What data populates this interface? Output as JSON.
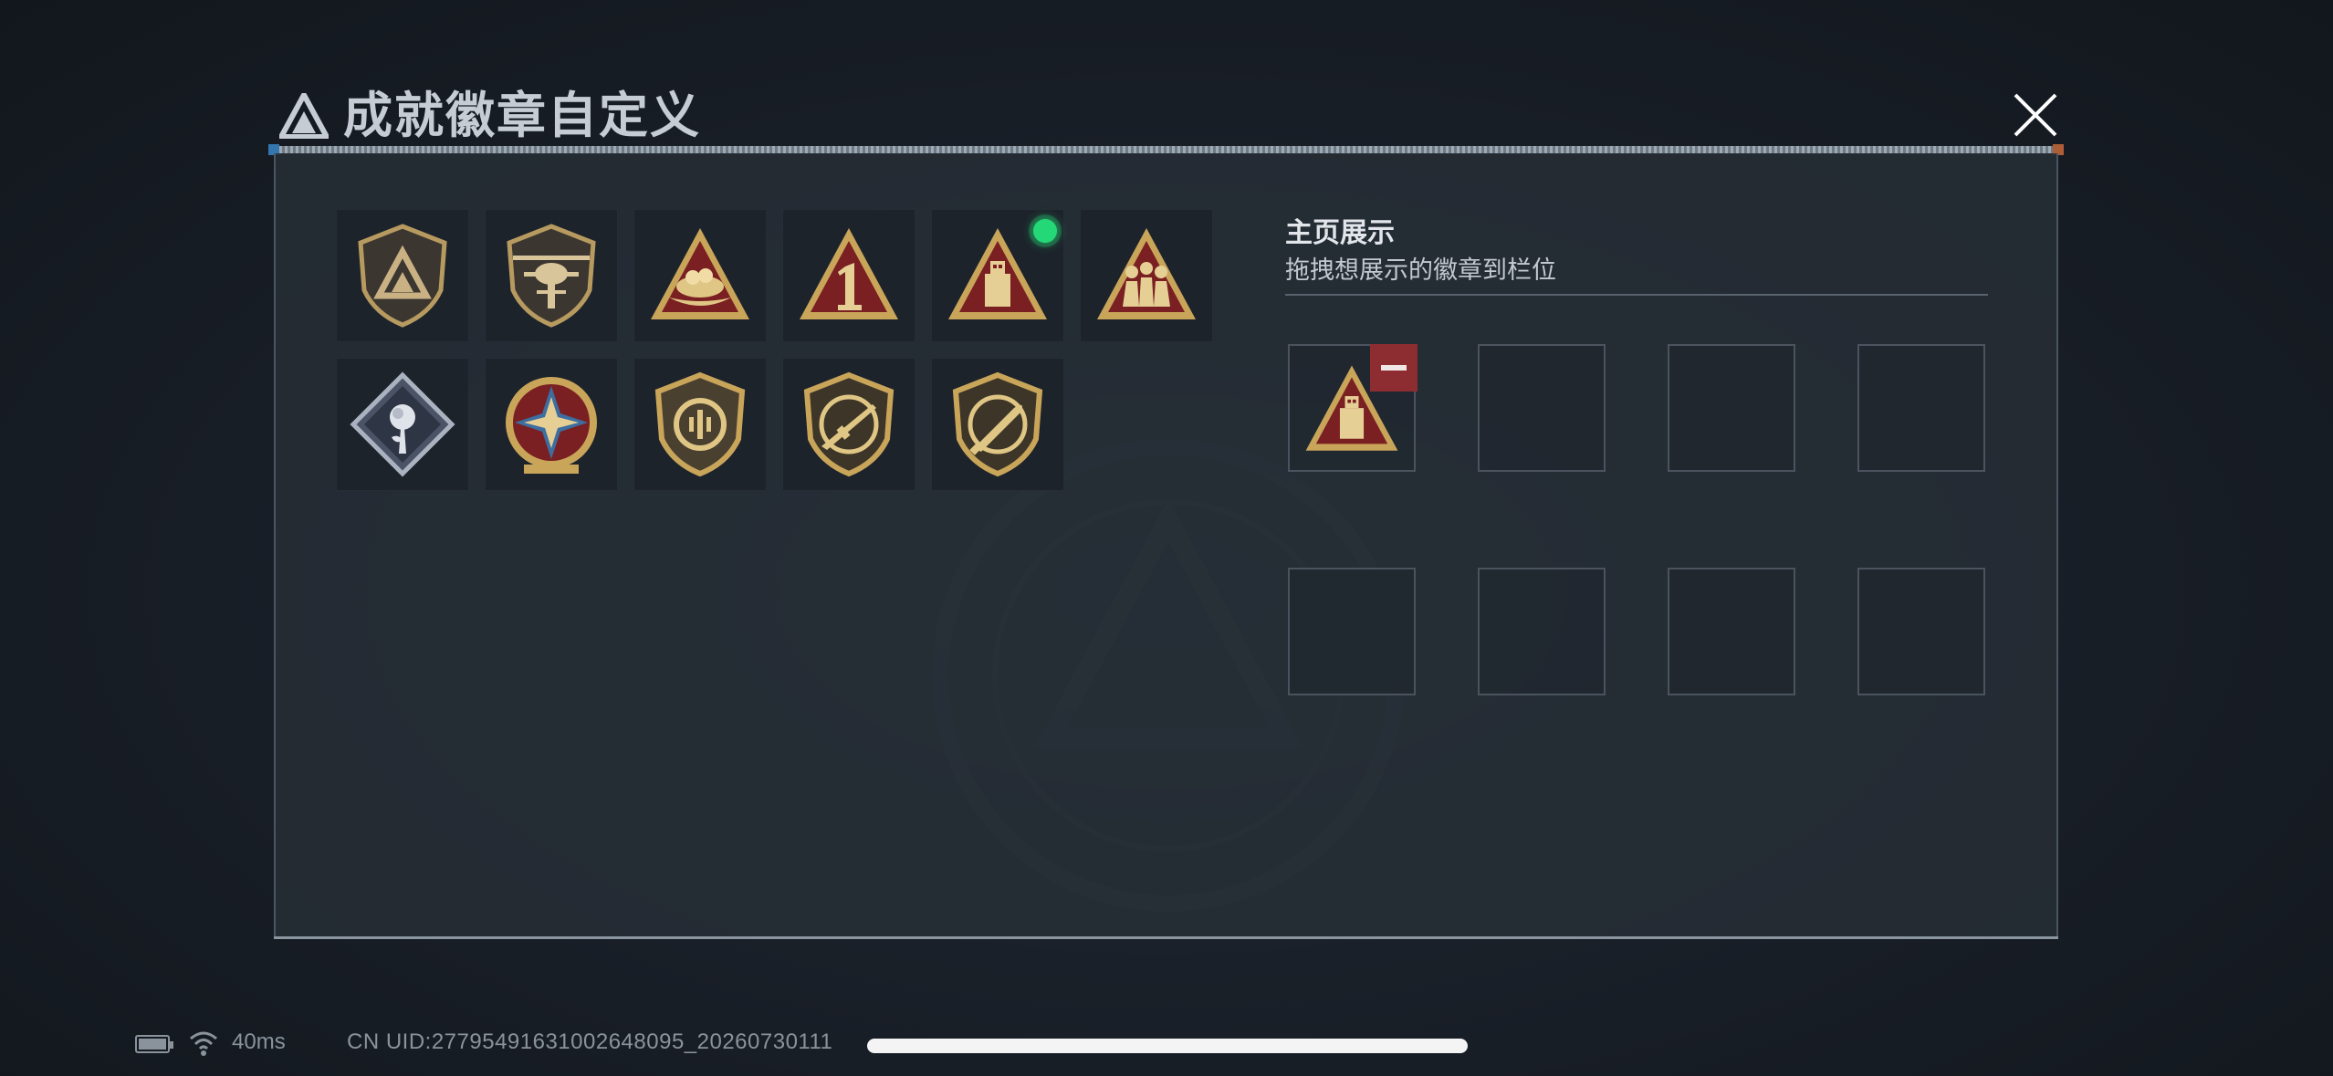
{
  "header": {
    "title": "成就徽章自定义",
    "logo_icon": "delta-triangle-logo",
    "close_icon": "close-x-icon"
  },
  "badges": [
    {
      "id": "b1",
      "icon": "shield-delta-badge-icon"
    },
    {
      "id": "b2",
      "icon": "helicopter-badge-icon"
    },
    {
      "id": "b3",
      "icon": "nest-triangle-badge-icon"
    },
    {
      "id": "b4",
      "icon": "number-one-triangle-badge-icon"
    },
    {
      "id": "b5",
      "icon": "usb-triangle-badge-icon",
      "new": true
    },
    {
      "id": "b6",
      "icon": "squad-triangle-badge-icon"
    },
    {
      "id": "b7",
      "icon": "rose-diamond-badge-icon"
    },
    {
      "id": "b8",
      "icon": "star-medal-badge-icon"
    },
    {
      "id": "b9",
      "icon": "vault-shield-badge-icon"
    },
    {
      "id": "b10",
      "icon": "rifle-shield-badge-icon"
    },
    {
      "id": "b11",
      "icon": "knife-shield-badge-icon"
    }
  ],
  "display": {
    "title": "主页展示",
    "subtitle": "拖拽想展示的徽章到栏位",
    "slots": [
      {
        "filled": true,
        "icon": "usb-triangle-badge-icon"
      },
      {
        "filled": false
      },
      {
        "filled": false
      },
      {
        "filled": false
      },
      {
        "filled": false
      },
      {
        "filled": false
      },
      {
        "filled": false
      },
      {
        "filled": false
      }
    ]
  },
  "status_bar": {
    "battery_icon": "battery-icon",
    "wifi_icon": "wifi-icon",
    "ping": "40ms",
    "uid": "CN UID:27795491631002648095_20260730111"
  },
  "colors": {
    "accent_green": "#25d877",
    "remove_red": "#8e2d31",
    "gold": "#c9a55a",
    "crimson": "#7a1f22"
  }
}
